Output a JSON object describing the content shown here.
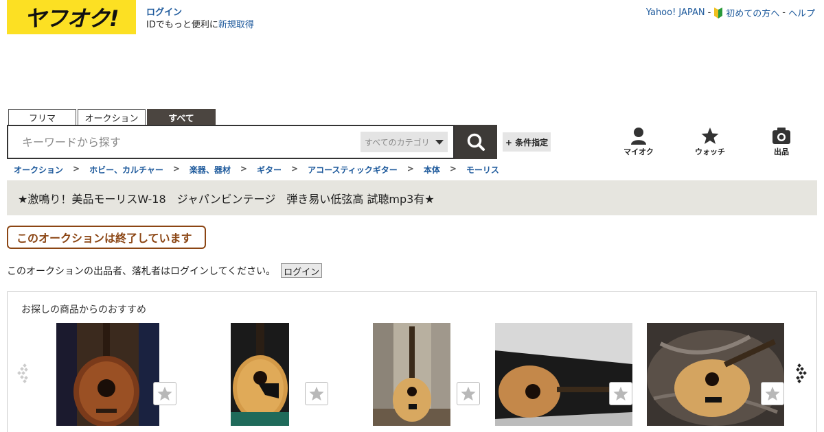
{
  "header": {
    "logo_text": "ヤフオク!",
    "login_link": "ログイン",
    "login_sub_prefix": "IDでもっと便利に",
    "signup_link": "新規取得",
    "top_links": [
      "Yahoo! JAPAN",
      "初めての方へ",
      "ヘルプ"
    ],
    "separator": "-"
  },
  "search": {
    "tabs": [
      "フリマ",
      "オークション",
      "すべて"
    ],
    "active_tab": "すべて",
    "placeholder": "キーワードから探す",
    "category": "すべてのカテゴリ",
    "conditions_button": "+ 条件指定"
  },
  "utility_nav": [
    {
      "label": "マイオク",
      "icon": "person-icon"
    },
    {
      "label": "ウォッチ",
      "icon": "star-icon"
    },
    {
      "label": "出品",
      "icon": "camera-icon"
    }
  ],
  "breadcrumb": [
    "オークション",
    "ホビー、カルチャー",
    "楽器、器材",
    "ギター",
    "アコースティックギター",
    "本体",
    "モーリス"
  ],
  "breadcrumb_sep": ">",
  "item_title": "★激鳴り！美品モーリスW-18　ジャパンビンテージ　弾き易い低弦高 試聴mp3有★",
  "ended_message": "このオークションは終了しています",
  "login_notice": "このオークションの出品者、落札者はログインしてください。",
  "login_button": "ログイン",
  "recommend": {
    "title": "お探しの商品からのおすすめ",
    "items": [
      {
        "image": "guitar-photo-case-dark"
      },
      {
        "image": "guitar-photo-case-green"
      },
      {
        "image": "guitar-photo-standing"
      },
      {
        "image": "guitar-photo-black-case"
      },
      {
        "image": "guitar-photo-marble"
      }
    ]
  },
  "colors": {
    "brand_yellow": "#fce023",
    "link_blue": "#1e5a9c",
    "ended_brown": "#8b4513",
    "title_bar_bg": "#e6e5df"
  }
}
